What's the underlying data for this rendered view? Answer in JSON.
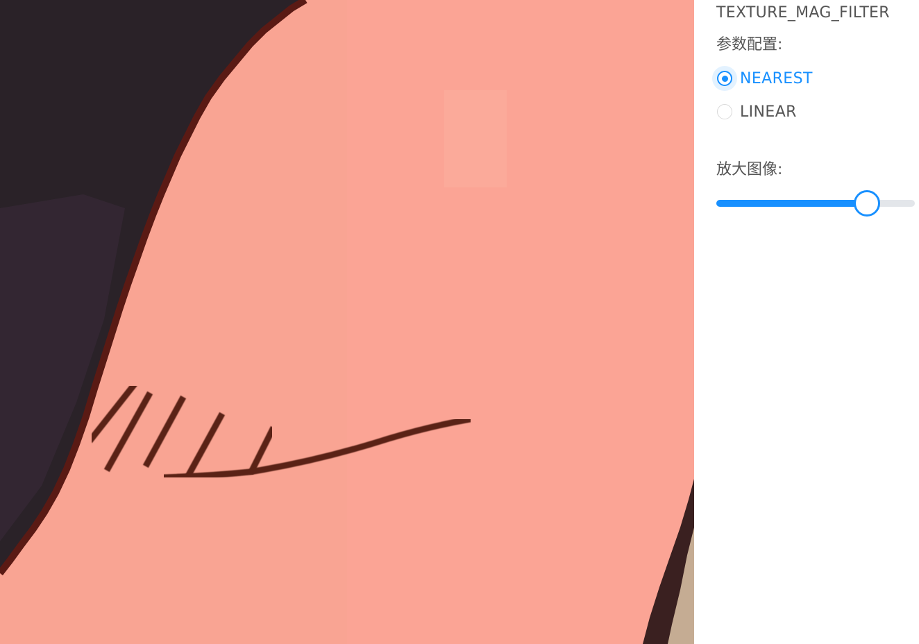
{
  "panel": {
    "param_name": "TEXTURE_MAG_FILTER",
    "config_label": "参数配置:",
    "filter_options": [
      {
        "label": "NEAREST",
        "checked": true
      },
      {
        "label": "LINEAR",
        "checked": false
      }
    ],
    "zoom_label": "放大图像:",
    "zoom_slider": {
      "level": 0.76
    }
  },
  "colors": {
    "accent": "#1890ff",
    "skin": "#f9a493",
    "hair": "#2a2228",
    "stroke": "#5a2418",
    "rail": "#e3e6ea"
  }
}
